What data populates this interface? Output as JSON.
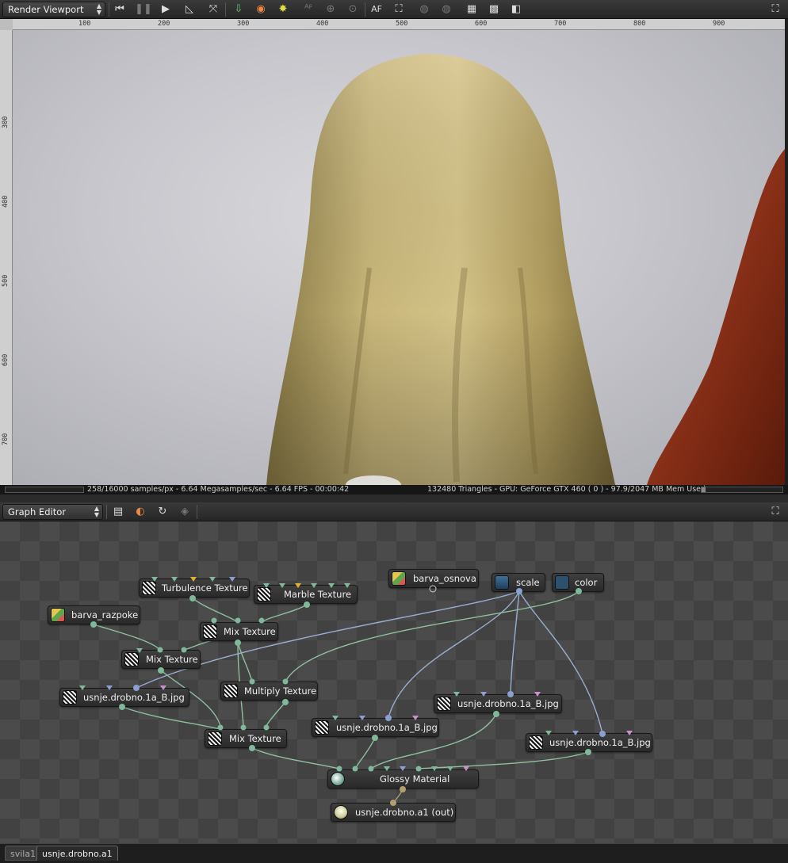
{
  "viewport": {
    "dropdown_label": "Render Viewport",
    "ruler_top": [
      "100",
      "200",
      "300",
      "400",
      "500",
      "600",
      "700",
      "800",
      "900"
    ],
    "ruler_left": [
      "300",
      "400",
      "500",
      "600",
      "700"
    ],
    "toolbar_buttons": [
      "skip-back",
      "pause",
      "play",
      "ruler",
      "fit",
      "import",
      "material-pick",
      "light",
      "af-dim",
      "focus-dim",
      "zoom-dim",
      "AF",
      "camera",
      "sphere-dim",
      "sphere2-dim",
      "checker",
      "checker2",
      "checker3"
    ],
    "af_label": "AF",
    "status_left": "258/16000 samples/px - 6.64 Megasamples/sec - 6.64 FPS - 00:00:42",
    "status_right": "132480 Triangles - GPU: GeForce GTX 460 ( 0 ) - 97.9/2047 MB Mem Used",
    "progress_fraction": 0.016
  },
  "graph_editor": {
    "dropdown_label": "Graph Editor",
    "nodes": {
      "turbulence": "Turbulence Texture",
      "marble": "Marble Texture",
      "barva_osnova": "barva_osnova",
      "scale": "scale",
      "color": "color",
      "barva_razpoke": "barva_razpoke",
      "mix1": "Mix Texture",
      "mix2": "Mix Texture",
      "multiply": "Multiply Texture",
      "img1": "usnje.drobno.1a_B.jpg",
      "img2": "usnje.drobno.1a_B.jpg",
      "img3": "usnje.drobno.1a_B.jpg",
      "img4": "usnje.drobno.1a_B.jpg",
      "mix3": "Mix Texture",
      "glossy": "Glossy Material",
      "out": "usnje.drobno.a1 (out)"
    }
  },
  "tabs": [
    "svila1",
    "usnje.drobno.a1"
  ],
  "colors": {
    "wire_green": "#8fc0a0",
    "wire_blue": "#9aaed0",
    "pin_green": "#7fb89a",
    "pin_blue": "#8aa0d0",
    "pin_pink": "#c890c8",
    "pin_yellow": "#e0b030"
  }
}
